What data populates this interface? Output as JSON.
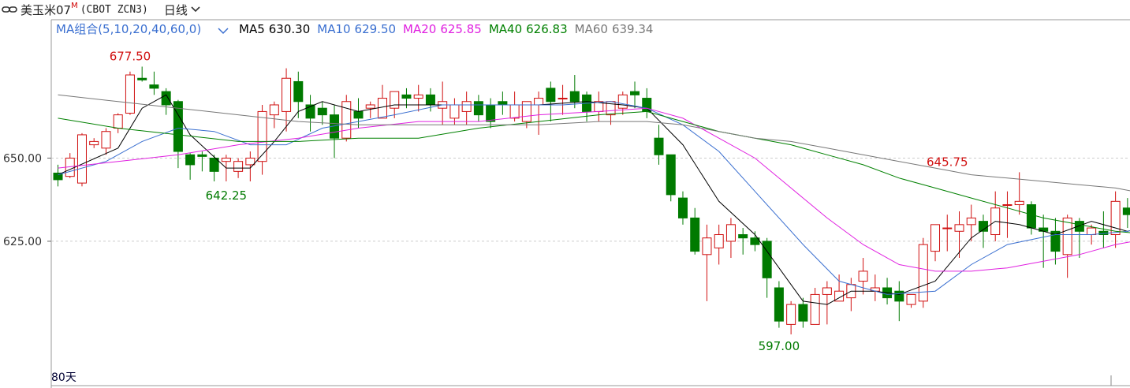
{
  "header": {
    "name": "美玉米07",
    "mark": "M",
    "code": "(CBOT ZCN3)",
    "period": "日线"
  },
  "legend": {
    "group_label": "MA组合(5,10,20,40,60,0)",
    "group_color": "#3a6fd0",
    "items": [
      {
        "name": "MA5",
        "value": "630.30",
        "color": "#000000"
      },
      {
        "name": "MA10",
        "value": "629.50",
        "color": "#3a6fd0"
      },
      {
        "name": "MA20",
        "value": "625.85",
        "color": "#e020e0"
      },
      {
        "name": "MA40",
        "value": "626.83",
        "color": "#008000"
      },
      {
        "name": "MA60",
        "value": "639.34",
        "color": "#777777"
      }
    ]
  },
  "colors": {
    "up": "#d01010",
    "down": "#007a00",
    "grid": "#cccccc"
  },
  "footer_label": "80天",
  "chart_data": {
    "type": "candlestick",
    "ylim": [
      581.6,
      691.6
    ],
    "yticks": [
      {
        "value": 650,
        "label": "650.00"
      },
      {
        "value": 625,
        "label": "625.00"
      }
    ],
    "annotations": [
      {
        "index": 6,
        "value": 677.5,
        "label": "677.50",
        "color": "#d01010",
        "pos": "above"
      },
      {
        "index": 14,
        "value": 642.25,
        "label": "642.25",
        "color": "#007a00",
        "pos": "below"
      },
      {
        "index": 60,
        "value": 597.0,
        "label": "597.00",
        "color": "#007a00",
        "pos": "below"
      },
      {
        "index": 74,
        "value": 645.75,
        "label": "645.75",
        "color": "#d01010",
        "pos": "above"
      }
    ],
    "candles": [
      [
        645.5,
        648,
        641.5,
        643.5
      ],
      [
        644.5,
        651.5,
        644,
        650
      ],
      [
        642.5,
        657.5,
        641.5,
        657
      ],
      [
        654,
        656,
        653,
        655
      ],
      [
        653,
        659,
        651,
        658
      ],
      [
        659,
        663.5,
        657.5,
        663
      ],
      [
        663.5,
        676,
        663,
        675
      ],
      [
        674,
        677.5,
        673,
        673.5
      ],
      [
        672,
        676,
        669,
        671
      ],
      [
        670,
        671,
        663,
        666
      ],
      [
        667,
        667.5,
        647,
        652
      ],
      [
        651,
        651.5,
        643.5,
        648
      ],
      [
        651,
        652,
        646,
        650.5
      ],
      [
        650,
        651,
        643,
        646
      ],
      [
        649,
        651,
        643,
        650
      ],
      [
        646,
        650,
        644,
        649
      ],
      [
        648,
        652,
        643,
        650
      ],
      [
        649,
        666,
        645,
        664
      ],
      [
        663,
        667,
        659,
        666
      ],
      [
        664,
        677,
        658,
        674
      ],
      [
        673,
        676,
        662,
        667
      ],
      [
        666,
        669,
        658,
        662
      ],
      [
        665,
        667,
        660,
        663
      ],
      [
        663,
        666,
        650,
        656
      ],
      [
        656,
        669,
        655,
        667
      ],
      [
        664,
        668,
        659,
        662
      ],
      [
        665,
        667,
        662,
        666
      ],
      [
        662,
        672,
        662,
        668
      ],
      [
        665,
        670,
        662,
        670
      ],
      [
        669,
        671,
        665,
        668
      ],
      [
        668,
        672,
        664,
        669
      ],
      [
        669,
        671,
        664,
        666
      ],
      [
        665,
        673,
        660,
        667
      ],
      [
        662,
        668,
        660,
        666
      ],
      [
        664,
        670,
        660,
        667
      ],
      [
        667,
        669,
        661,
        663
      ],
      [
        666,
        668,
        659,
        661
      ],
      [
        667,
        670,
        663,
        666
      ],
      [
        662,
        670,
        661,
        666
      ],
      [
        661,
        667,
        659,
        667
      ],
      [
        666,
        670,
        657,
        668
      ],
      [
        671,
        673,
        661,
        667
      ],
      [
        668,
        672,
        663,
        668
      ],
      [
        670,
        675,
        665,
        667
      ],
      [
        669,
        670,
        661,
        664
      ],
      [
        664,
        670,
        661,
        667
      ],
      [
        663,
        665,
        660,
        667
      ],
      [
        665,
        670,
        663,
        669
      ],
      [
        670,
        673,
        665,
        669
      ],
      [
        668,
        671,
        662,
        664
      ],
      [
        656,
        660,
        648,
        651
      ],
      [
        651,
        651,
        637,
        639
      ],
      [
        638,
        640,
        630,
        632
      ],
      [
        632,
        635,
        621,
        622
      ],
      [
        621,
        630,
        607,
        626
      ],
      [
        623,
        630,
        618,
        627
      ],
      [
        625,
        632,
        620,
        630
      ],
      [
        627,
        629,
        621,
        626
      ],
      [
        626,
        628,
        622,
        624
      ],
      [
        625,
        626,
        608,
        614
      ],
      [
        611,
        613,
        599,
        601
      ],
      [
        600,
        607,
        597,
        606
      ],
      [
        606,
        608,
        599,
        601
      ],
      [
        600,
        611,
        600,
        609
      ],
      [
        609,
        613,
        600,
        611
      ],
      [
        607,
        615,
        607,
        610
      ],
      [
        608,
        614,
        604,
        612
      ],
      [
        613,
        620,
        609,
        616
      ],
      [
        610,
        615,
        607,
        611
      ],
      [
        611,
        614,
        606,
        608
      ],
      [
        610,
        613,
        601,
        607
      ],
      [
        606,
        609,
        605,
        609
      ],
      [
        607,
        626,
        605,
        624
      ],
      [
        622,
        630,
        619,
        630
      ],
      [
        629,
        633,
        622,
        629
      ],
      [
        628,
        634,
        620,
        630
      ],
      [
        630,
        636,
        625,
        632
      ],
      [
        631,
        633,
        623,
        628
      ],
      [
        627,
        640,
        625,
        635
      ],
      [
        636,
        640,
        626,
        636
      ],
      [
        636,
        645.75,
        633,
        637
      ],
      [
        636,
        637,
        627,
        629
      ],
      [
        629,
        633,
        617,
        628
      ],
      [
        628,
        632,
        618,
        622
      ],
      [
        621,
        633,
        614,
        632
      ],
      [
        631,
        632,
        620,
        628
      ],
      [
        627,
        630,
        624,
        629
      ],
      [
        628,
        634,
        623,
        627
      ],
      [
        627,
        640,
        623,
        637
      ],
      [
        635,
        638,
        629,
        633
      ]
    ],
    "series": [
      {
        "name": "MA5",
        "color": "#000000",
        "points": [
          [
            0,
            645
          ],
          [
            5,
            653
          ],
          [
            7,
            665
          ],
          [
            9,
            669
          ],
          [
            11,
            657
          ],
          [
            14,
            647
          ],
          [
            16,
            647
          ],
          [
            18,
            655
          ],
          [
            20,
            664
          ],
          [
            22,
            667
          ],
          [
            25,
            664
          ],
          [
            28,
            666
          ],
          [
            32,
            666
          ],
          [
            36,
            666
          ],
          [
            40,
            666
          ],
          [
            44,
            667
          ],
          [
            47,
            666
          ],
          [
            49,
            665
          ],
          [
            52,
            654
          ],
          [
            55,
            637
          ],
          [
            58,
            627
          ],
          [
            61,
            612
          ],
          [
            62,
            607
          ],
          [
            64,
            606
          ],
          [
            66,
            610
          ],
          [
            68,
            610
          ],
          [
            70,
            609
          ],
          [
            73,
            613
          ],
          [
            76,
            626
          ],
          [
            78,
            631
          ],
          [
            80,
            630
          ],
          [
            83,
            627
          ],
          [
            86,
            631
          ],
          [
            89,
            628
          ],
          [
            91,
            630
          ]
        ]
      },
      {
        "name": "MA10",
        "color": "#3a6fd0",
        "points": [
          [
            0,
            645
          ],
          [
            4,
            649
          ],
          [
            7,
            655
          ],
          [
            10,
            659
          ],
          [
            13,
            658
          ],
          [
            16,
            654
          ],
          [
            19,
            654
          ],
          [
            22,
            659
          ],
          [
            25,
            661
          ],
          [
            28,
            663
          ],
          [
            32,
            666
          ],
          [
            37,
            666
          ],
          [
            42,
            666
          ],
          [
            46,
            667
          ],
          [
            49,
            665
          ],
          [
            52,
            660
          ],
          [
            55,
            652
          ],
          [
            58,
            640
          ],
          [
            62,
            624
          ],
          [
            65,
            613
          ],
          [
            69,
            609
          ],
          [
            73,
            610
          ],
          [
            76,
            618
          ],
          [
            79,
            624
          ],
          [
            83,
            627
          ],
          [
            86,
            627
          ],
          [
            89,
            628
          ],
          [
            91,
            630
          ]
        ]
      },
      {
        "name": "MA20",
        "color": "#e020e0",
        "points": [
          [
            0,
            647
          ],
          [
            5,
            649
          ],
          [
            10,
            651
          ],
          [
            15,
            654
          ],
          [
            20,
            656
          ],
          [
            25,
            659
          ],
          [
            30,
            661
          ],
          [
            35,
            661
          ],
          [
            40,
            663
          ],
          [
            45,
            664
          ],
          [
            49,
            665
          ],
          [
            52,
            662
          ],
          [
            55,
            656
          ],
          [
            58,
            650
          ],
          [
            61,
            641
          ],
          [
            64,
            632
          ],
          [
            67,
            624
          ],
          [
            70,
            618
          ],
          [
            73,
            616
          ],
          [
            76,
            616
          ],
          [
            79,
            617
          ],
          [
            82,
            619
          ],
          [
            85,
            621
          ],
          [
            88,
            624
          ],
          [
            91,
            626
          ]
        ]
      },
      {
        "name": "MA40",
        "color": "#008000",
        "points": [
          [
            0,
            662
          ],
          [
            5,
            659
          ],
          [
            10,
            657
          ],
          [
            15,
            655
          ],
          [
            20,
            655
          ],
          [
            25,
            656
          ],
          [
            30,
            656
          ],
          [
            35,
            659
          ],
          [
            40,
            661
          ],
          [
            45,
            663
          ],
          [
            49,
            664
          ],
          [
            52,
            661
          ],
          [
            55,
            658
          ],
          [
            58,
            656
          ],
          [
            61,
            654
          ],
          [
            64,
            651
          ],
          [
            67,
            648
          ],
          [
            70,
            644
          ],
          [
            73,
            641
          ],
          [
            76,
            638
          ],
          [
            79,
            635
          ],
          [
            82,
            632
          ],
          [
            85,
            630
          ],
          [
            88,
            628
          ],
          [
            91,
            627
          ]
        ]
      },
      {
        "name": "MA60",
        "color": "#777777",
        "points": [
          [
            0,
            669
          ],
          [
            5,
            667
          ],
          [
            10,
            665
          ],
          [
            15,
            663
          ],
          [
            20,
            661
          ],
          [
            25,
            660
          ],
          [
            30,
            660
          ],
          [
            35,
            660
          ],
          [
            40,
            660
          ],
          [
            45,
            661
          ],
          [
            49,
            661
          ],
          [
            52,
            660
          ],
          [
            55,
            658
          ],
          [
            58,
            656
          ],
          [
            61,
            655
          ],
          [
            64,
            653
          ],
          [
            67,
            651
          ],
          [
            70,
            649
          ],
          [
            73,
            647
          ],
          [
            76,
            645
          ],
          [
            79,
            644
          ],
          [
            82,
            643
          ],
          [
            85,
            642
          ],
          [
            88,
            641
          ],
          [
            91,
            639
          ]
        ]
      }
    ]
  }
}
